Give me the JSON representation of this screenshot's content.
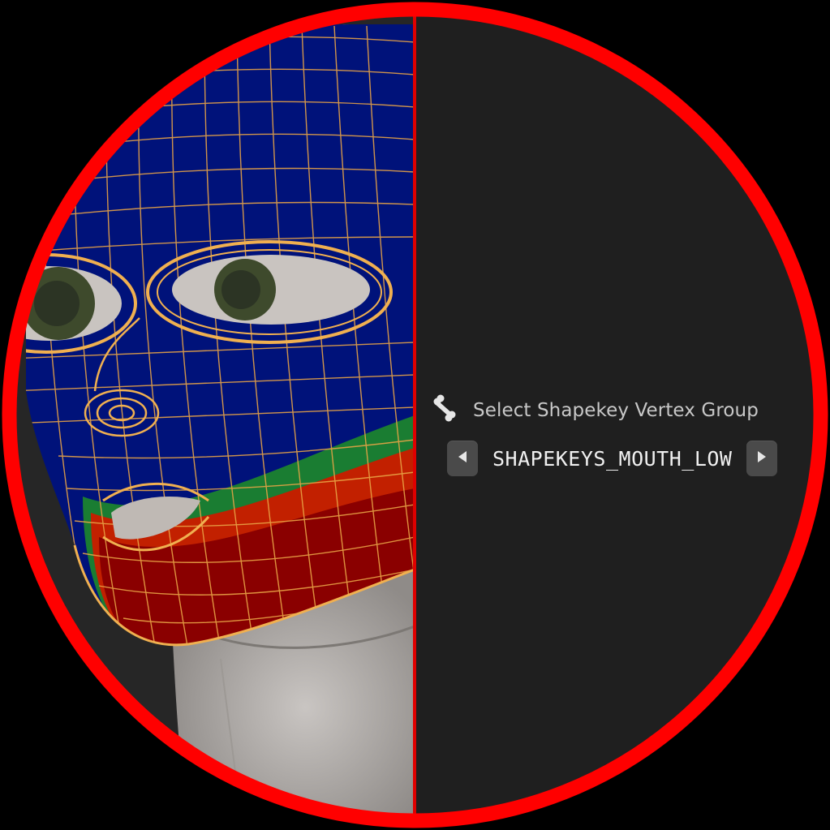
{
  "panel": {
    "label": "Select Shapekey Vertex Group",
    "label_icon": "bone-icon",
    "vertex_group_value": "SHAPEKEYS_MOUTH_LOW",
    "prev_icon": "triangle-left-icon",
    "next_icon": "triangle-right-icon"
  },
  "colors": {
    "ring": "#ff0000",
    "panel_bg": "#1f1f1f",
    "weight_zero": "#000080",
    "weight_full": "#8b0000",
    "wireframe": "#e0a040"
  }
}
